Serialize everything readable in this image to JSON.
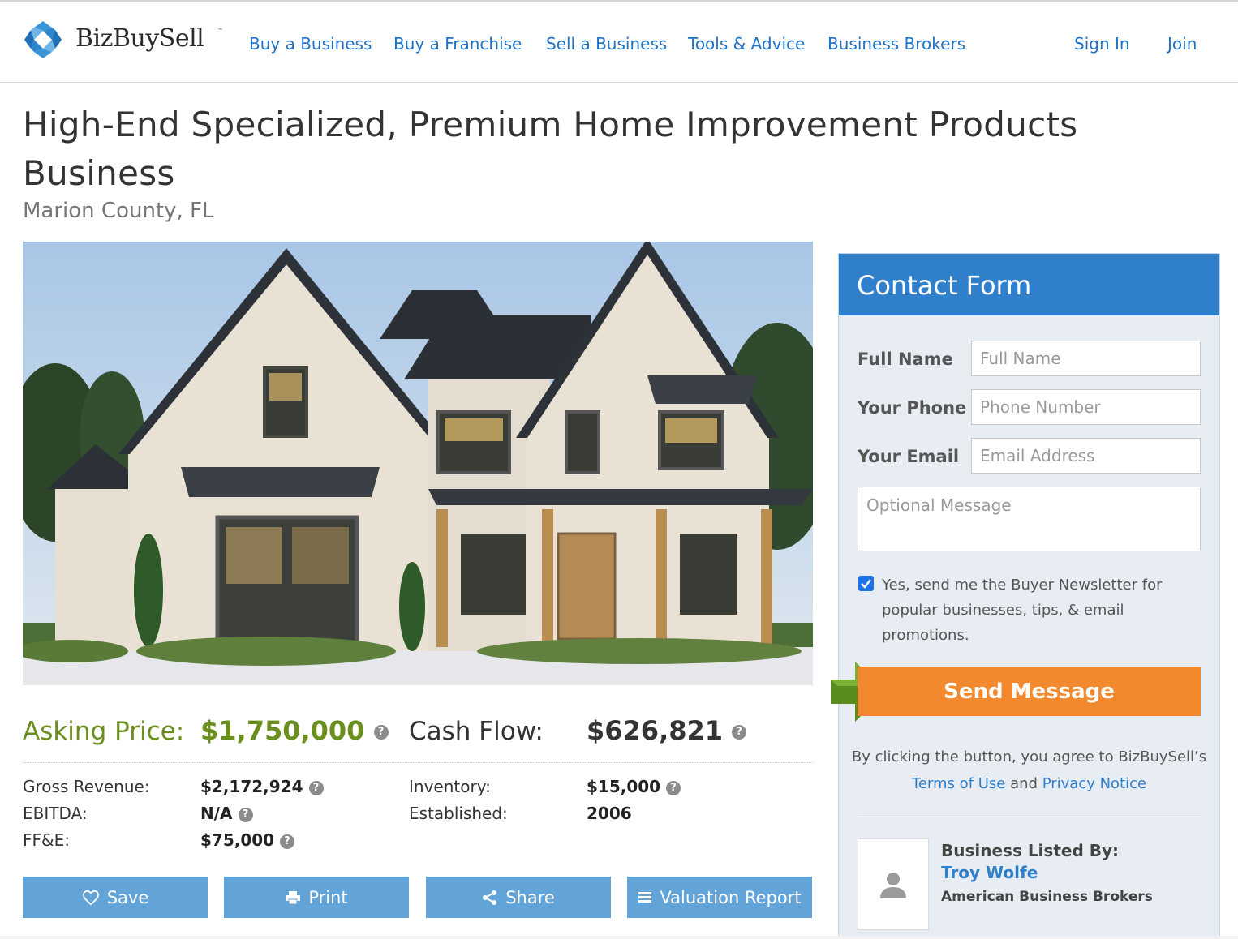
{
  "brand": {
    "name": "BizBuySell",
    "trademark": "™"
  },
  "nav": {
    "items": [
      {
        "label": "Buy a Business"
      },
      {
        "label": "Buy a Franchise"
      },
      {
        "label": "Sell a Business"
      },
      {
        "label": "Tools & Advice"
      },
      {
        "label": "Business Brokers"
      }
    ],
    "sign_in": "Sign In",
    "join": "Join"
  },
  "listing": {
    "title": "High-End Specialized, Premium Home Improvement Products Business",
    "location": "Marion County, FL",
    "asking_price_label": "Asking Price:",
    "asking_price": "$1,750,000",
    "cash_flow_label": "Cash Flow:",
    "cash_flow": "$626,821",
    "details_left": [
      {
        "label": "Gross Revenue:",
        "value": "$2,172,924",
        "help": true
      },
      {
        "label": "EBITDA:",
        "value": "N/A",
        "help": true
      },
      {
        "label": "FF&E:",
        "value": "$75,000",
        "help": true
      }
    ],
    "details_right": [
      {
        "label": "Inventory:",
        "value": "$15,000",
        "help": true
      },
      {
        "label": "Established:",
        "value": "2006",
        "help": false
      }
    ],
    "help_glyph": "?"
  },
  "actions": {
    "save": "Save",
    "print": "Print",
    "share": "Share",
    "valuation": "Valuation Report"
  },
  "contact_form": {
    "title": "Contact Form",
    "full_name_label": "Full Name",
    "full_name_placeholder": "Full Name",
    "phone_label": "Your Phone",
    "phone_placeholder": "Phone Number",
    "email_label": "Your Email",
    "email_placeholder": "Email Address",
    "message_placeholder": "Optional Message",
    "newsletter_checked": true,
    "newsletter_text": "Yes, send me the Buyer Newsletter for popular businesses, tips, & email promotions.",
    "send_label": "Send Message",
    "agree_text": "By clicking the button, you agree to BizBuySell’s",
    "terms_link": "Terms of Use",
    "and_text": "and",
    "privacy_link": "Privacy Notice"
  },
  "broker": {
    "listed_by_label": "Business Listed By:",
    "name": "Troy Wolfe",
    "company": "American Business Brokers"
  },
  "colors": {
    "brand_blue": "#2f7fcb",
    "nav_link": "#1f72c4",
    "price_green": "#6a8f1e",
    "action_button": "#62a4d8",
    "send_orange": "#f2892f",
    "arrow_green": "#5b8c1f"
  }
}
